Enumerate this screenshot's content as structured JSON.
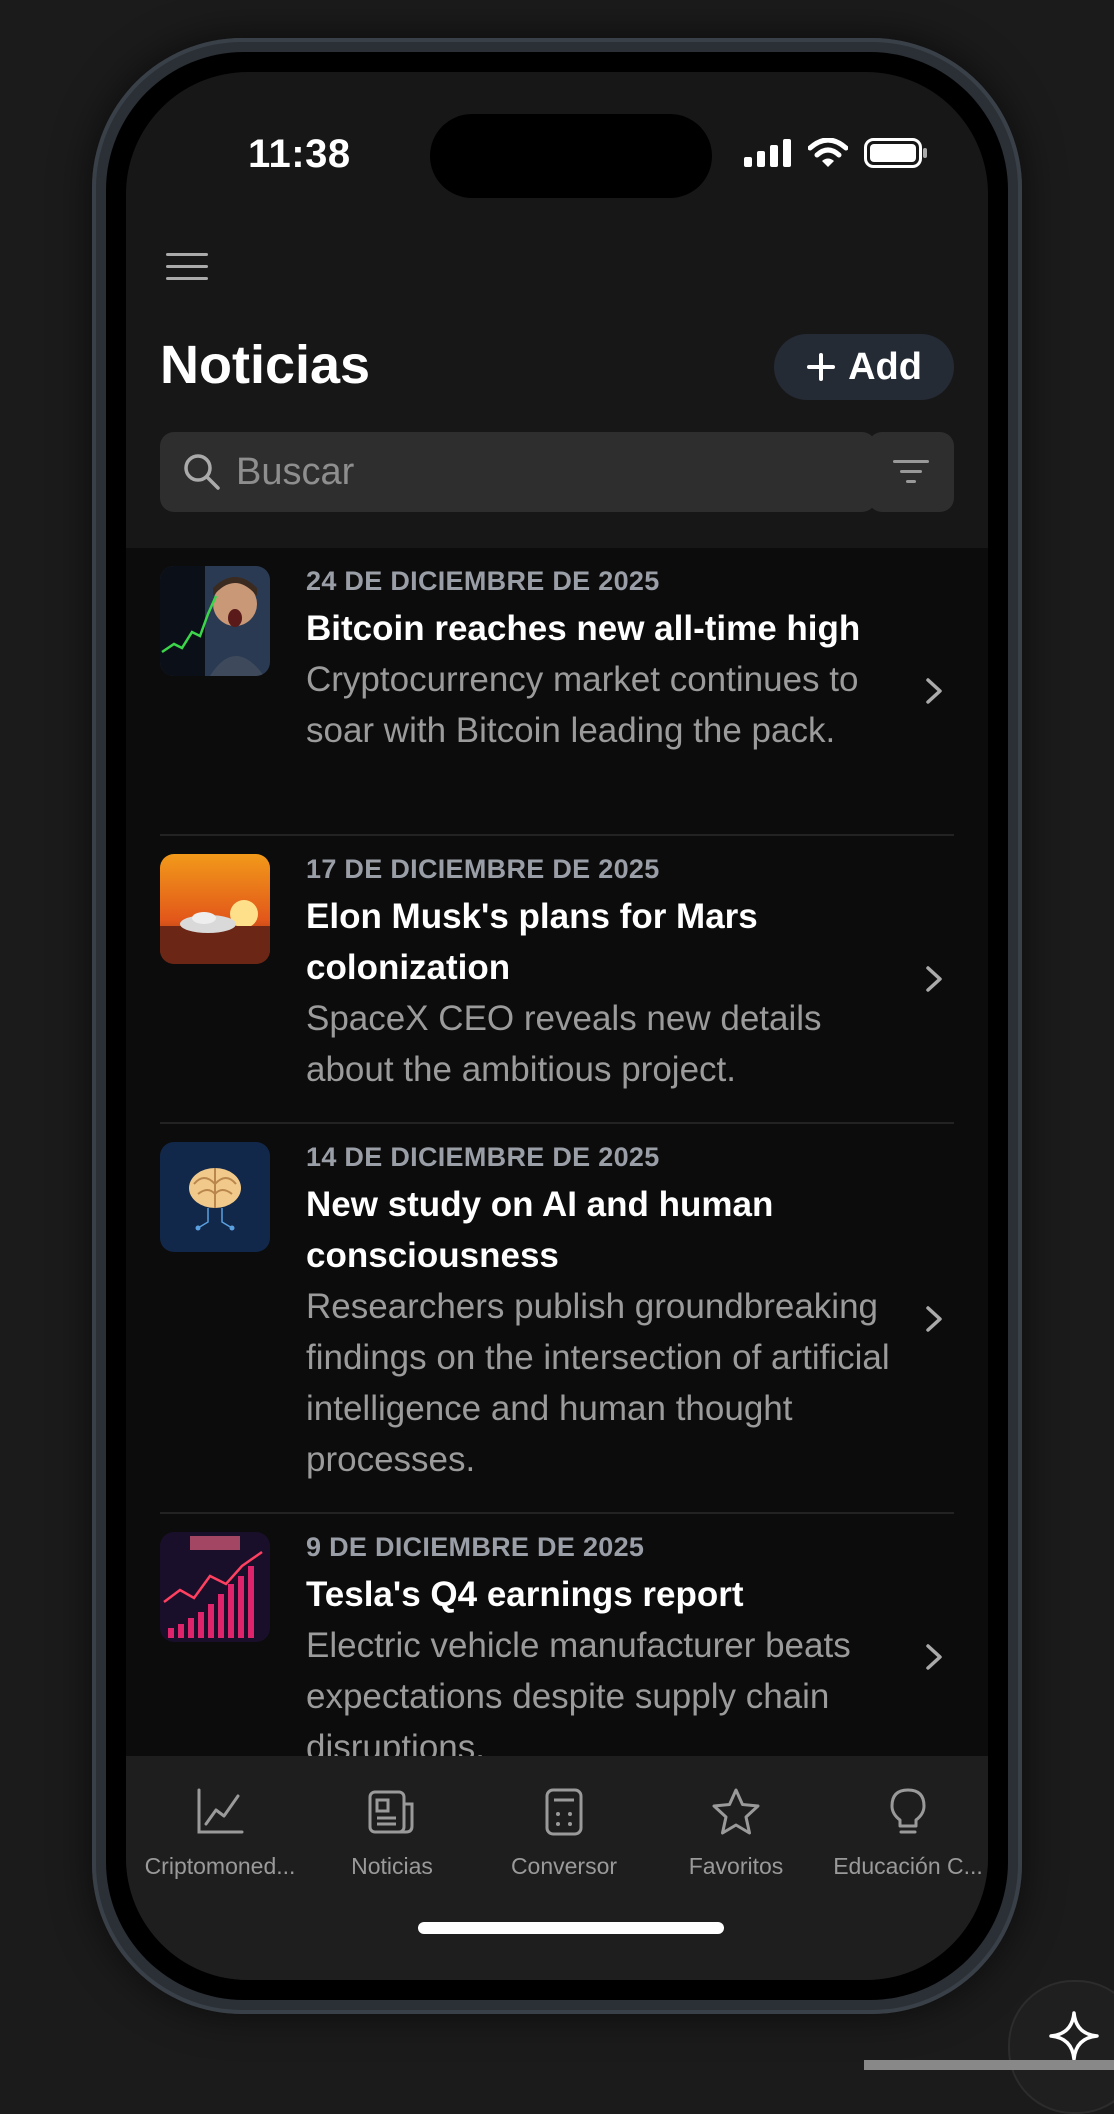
{
  "status_bar": {
    "time": "11:38"
  },
  "header": {
    "title": "Noticias",
    "add_label": "Add"
  },
  "search": {
    "placeholder": "Buscar"
  },
  "news": [
    {
      "date": "24 DE DICIEMBRE DE 2025",
      "title": "Bitcoin reaches new all-time high",
      "summary": "Cryptocurrency market continues to soar with Bitcoin leading the pack.",
      "thumb": "bitcoin-thumbnail"
    },
    {
      "date": "17 DE DICIEMBRE DE 2025",
      "title": "Elon Musk's plans for Mars colonization",
      "summary": "SpaceX CEO reveals new details about the ambitious project.",
      "thumb": "mars-thumbnail"
    },
    {
      "date": "14 DE DICIEMBRE DE 2025",
      "title": "New study on AI and human consciousness",
      "summary": "Researchers publish groundbreaking findings on the intersection of artificial intelligence and human thought processes.",
      "thumb": "brain-thumbnail"
    },
    {
      "date": "9 DE DICIEMBRE DE 2025",
      "title": "Tesla's Q4 earnings report",
      "summary": "Electric vehicle manufacturer beats expectations despite supply chain disruptions.",
      "thumb": "chart-thumbnail"
    }
  ],
  "tabs": [
    {
      "label": "Criptomoned...",
      "icon": "chart-line-icon"
    },
    {
      "label": "Noticias",
      "icon": "newspaper-icon"
    },
    {
      "label": "Conversor",
      "icon": "calculator-icon"
    },
    {
      "label": "Favoritos",
      "icon": "star-icon"
    },
    {
      "label": "Educación C...",
      "icon": "lightbulb-icon"
    }
  ],
  "colors": {
    "background": "#171717",
    "list_background": "#0c0c0c",
    "accent_button": "#242b35",
    "text_primary": "#ffffff",
    "text_secondary": "#9b9b9b"
  }
}
